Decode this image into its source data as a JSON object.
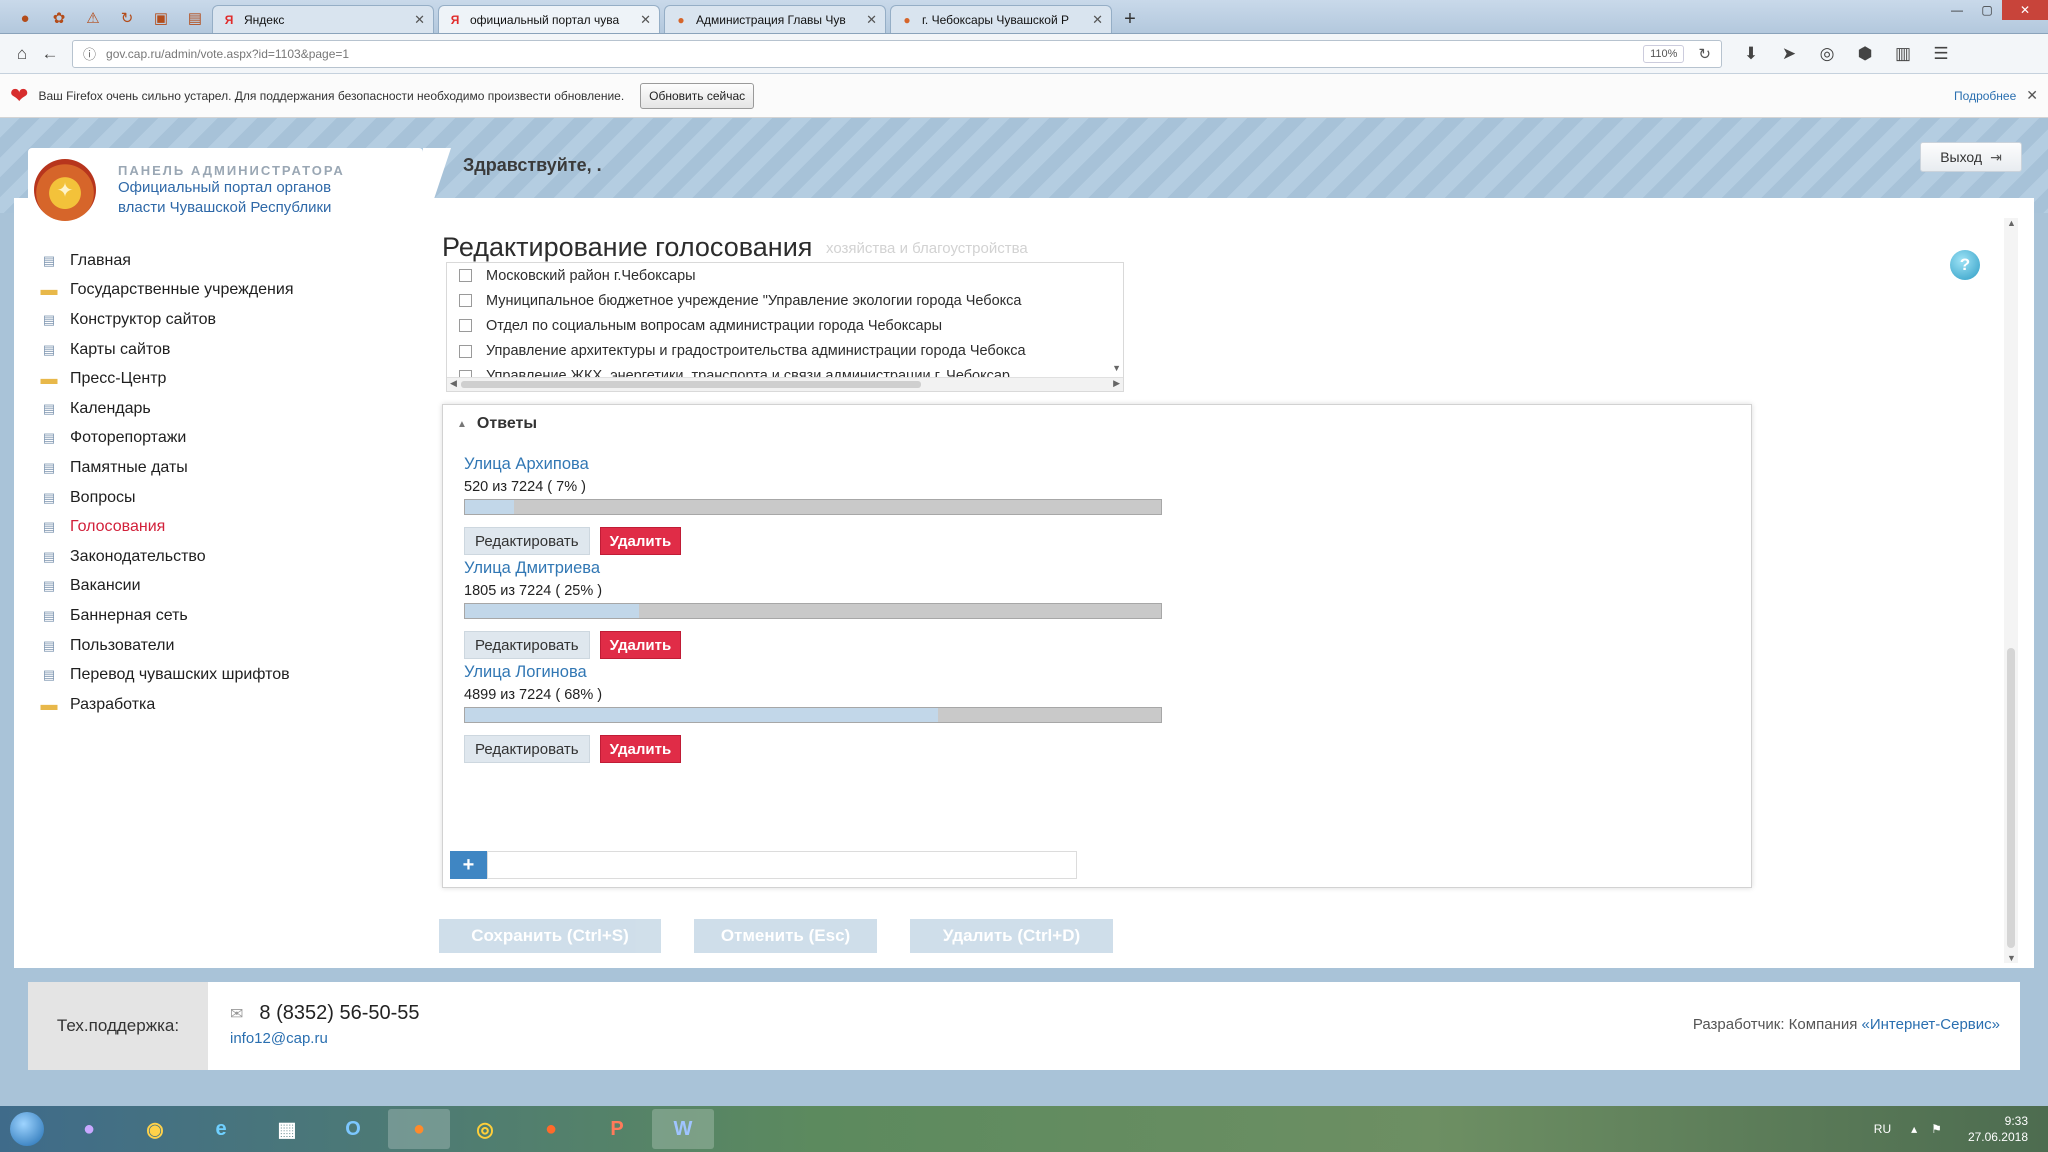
{
  "browser": {
    "tabs": [
      {
        "title": "Яндекс",
        "icon": "Я",
        "icon_color": "#e02c2c"
      },
      {
        "title": "официальный портал чува",
        "icon": "Я",
        "icon_color": "#e02c2c"
      },
      {
        "title": "Администрация Главы Чув",
        "icon": "●",
        "icon_color": "#d6652a"
      },
      {
        "title": "г. Чебоксары Чувашской Р",
        "icon": "●",
        "icon_color": "#d6652a"
      }
    ],
    "url": "gov.cap.ru/admin/vote.aspx?id=1103&page=1",
    "zoom": "110%",
    "notification": {
      "text": "Ваш Firefox очень сильно устарел. Для поддержания безопасности необходимо произвести обновление.",
      "button": "Обновить сейчас",
      "more": "Подробнее"
    }
  },
  "header": {
    "panel_label": "ПАНЕЛЬ АДМИНИСТРАТОРА",
    "portal_line1": "Официальный портал органов",
    "portal_line2": "власти Чувашской Республики",
    "greeting": "Здравствуйте, .",
    "logout": "Выход"
  },
  "sidebar": {
    "items": [
      {
        "label": "Главная",
        "icon": "page"
      },
      {
        "label": "Государственные учреждения",
        "icon": "folder"
      },
      {
        "label": "Конструктор сайтов",
        "icon": "page"
      },
      {
        "label": "Карты сайтов",
        "icon": "page"
      },
      {
        "label": "Пресс-Центр",
        "icon": "folder"
      },
      {
        "label": "Календарь",
        "icon": "page"
      },
      {
        "label": "Фоторепортажи",
        "icon": "page"
      },
      {
        "label": "Памятные даты",
        "icon": "page"
      },
      {
        "label": "Вопросы",
        "icon": "page"
      },
      {
        "label": "Голосования",
        "icon": "page",
        "active": true
      },
      {
        "label": "Законодательство",
        "icon": "page"
      },
      {
        "label": "Вакансии",
        "icon": "page"
      },
      {
        "label": "Баннерная сеть",
        "icon": "page"
      },
      {
        "label": "Пользователи",
        "icon": "page"
      },
      {
        "label": "Перевод чувашских шрифтов",
        "icon": "page"
      },
      {
        "label": "Разработка",
        "icon": "folder"
      }
    ]
  },
  "editor": {
    "title": "Редактирование голосования",
    "ghost_text": "хозяйства и благоустройства",
    "orgs": [
      "Московский район г.Чебоксары",
      "Муниципальное бюджетное учреждение \"Управление экологии города Чебокса",
      "Отдел по социальным вопросам администрации города Чебоксары",
      "Управление архитектуры и градостроительства администрации города Чебокса",
      "Управление ЖКХ, энергетики, транспорта и связи администрации г. Чебоксар"
    ]
  },
  "answers": {
    "heading": "Ответы",
    "items": [
      {
        "name": "Улица Архипова",
        "count": "520 из 7224 ( 7% )",
        "percent": 7
      },
      {
        "name": "Улица Дмитриева",
        "count": "1805 из 7224 ( 25% )",
        "percent": 25
      },
      {
        "name": "Улица Логинова",
        "count": "4899 из 7224 ( 68% )",
        "percent": 68
      }
    ],
    "edit_label": "Редактировать",
    "delete_label": "Удалить",
    "add_label": "+"
  },
  "actions": {
    "save": "Сохранить (Ctrl+S)",
    "cancel": "Отменить (Esc)",
    "delete": "Удалить (Ctrl+D)"
  },
  "footer": {
    "support_label": "Тех.поддержка:",
    "phone": "8 (8352) 56-50-55",
    "email": "info12@cap.ru",
    "developer_prefix": "Разработчик: Компания ",
    "developer_name": "«Интернет-Сервис»"
  },
  "taskbar": {
    "lang": "RU",
    "time": "9:33",
    "date": "27.06.2018"
  },
  "colors": {
    "accent": "#3177b4",
    "danger": "#e02c47",
    "active_nav": "#d2203a"
  }
}
